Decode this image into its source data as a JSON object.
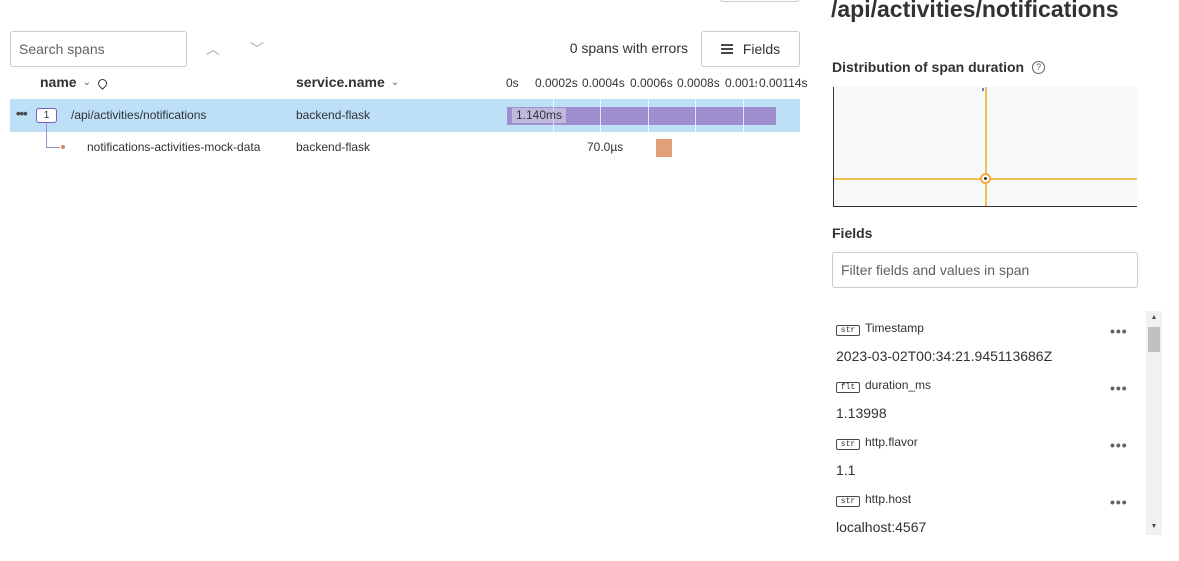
{
  "toolbar": {
    "search_placeholder": "Search spans",
    "errors_text": "0 spans with errors",
    "fields_button": "Fields"
  },
  "columns": {
    "name": "name",
    "service": "service.name"
  },
  "timeline_ticks": [
    "0s",
    "0.0002s",
    "0.0004s",
    "0.0006s",
    "0.0008s",
    "0.001s",
    "0.00114s"
  ],
  "spans": [
    {
      "count": "1",
      "name": "/api/activities/notifications",
      "service": "backend-flask",
      "duration_label": "1.140ms"
    },
    {
      "name": "notifications-activities-mock-data",
      "service": "backend-flask",
      "duration_label": "70.0µs"
    }
  ],
  "detail": {
    "title": "/api/activities/notifications",
    "distribution_title": "Distribution of span duration",
    "help_glyph": "?",
    "fields_title": "Fields",
    "filter_placeholder": "Filter fields and values in span",
    "fields": [
      {
        "type": "str",
        "key": "Timestamp",
        "value": "2023-03-02T00:34:21.945113686Z"
      },
      {
        "type": "flt",
        "key": "duration_ms",
        "value": "1.13998"
      },
      {
        "type": "str",
        "key": "http.flavor",
        "value": "1.1"
      },
      {
        "type": "str",
        "key": "http.host",
        "value": "localhost:4567"
      }
    ]
  },
  "colors": {
    "selected_row": "#bde0f7",
    "root_bar": "#a08fd0",
    "child_bar": "#e1a07a",
    "heatmap_line": "#f2c14e"
  }
}
